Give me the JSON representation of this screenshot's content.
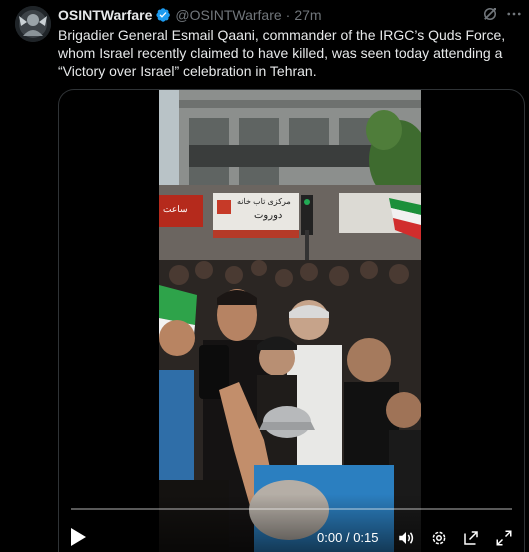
{
  "tweet": {
    "author_name": "OSINTWarfare",
    "handle": "@OSINTWarfare",
    "separator": "·",
    "time": "27m",
    "verified": true,
    "text": "Brigadier General Esmail Qaani, commander of the IRGC’s Quds Force, whom Israel recently claimed to have killed, was seen today attending a “Victory over Israel” celebration in Tehran.",
    "avatar_icon": "avatar-image",
    "grok_icon": "grok-icon",
    "more_icon": "more-icon"
  },
  "video": {
    "current_time": "0:00",
    "time_separator": "/",
    "duration": "0:15",
    "progress": 0,
    "icons": [
      "play-icon",
      "volume-icon",
      "settings-icon",
      "picture-in-picture-icon",
      "fullscreen-icon"
    ],
    "shop_sign_text": "مرکزی تاب خانه",
    "shop_sign_text2": "دوروت"
  },
  "colors": {
    "background": "#000000",
    "text": "#e7e9ea",
    "muted": "#71767b",
    "verified": "#1d9bf0",
    "border": "#2f3336"
  }
}
